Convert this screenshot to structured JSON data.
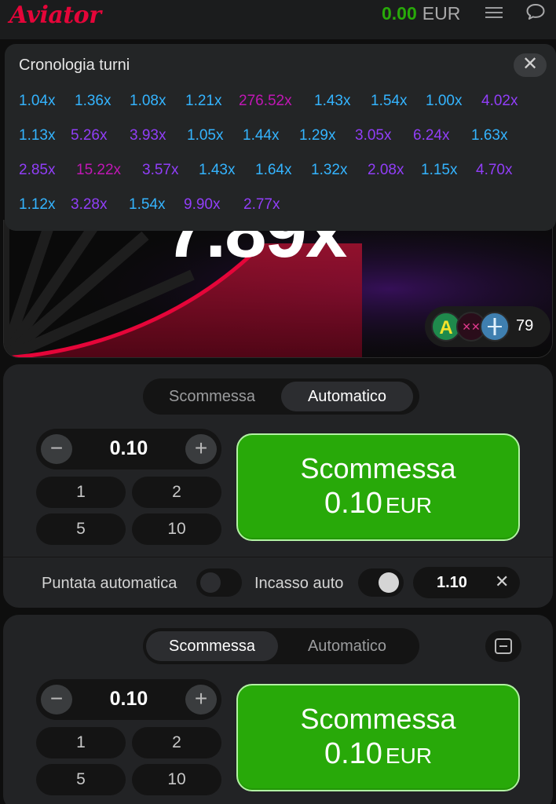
{
  "header": {
    "logo": "Aviator",
    "balance_amount": "0.00",
    "balance_currency": "EUR",
    "icons": [
      "menu-icon",
      "chat-icon"
    ]
  },
  "game": {
    "multiplier": "7.89x",
    "players_count": "79"
  },
  "history": {
    "title": "Cronologia turni",
    "close_label": "✕",
    "items": [
      {
        "label": "1.04x",
        "color": "#34b4ff"
      },
      {
        "label": "1.36x",
        "color": "#34b4ff"
      },
      {
        "label": "1.08x",
        "color": "#34b4ff"
      },
      {
        "label": "1.21x",
        "color": "#34b4ff"
      },
      {
        "label": "276.52x",
        "color": "#c017b4"
      },
      {
        "label": "1.43x",
        "color": "#34b4ff"
      },
      {
        "label": "1.54x",
        "color": "#34b4ff"
      },
      {
        "label": "1.00x",
        "color": "#34b4ff"
      },
      {
        "label": "4.02x",
        "color": "#913ef8"
      },
      {
        "label": "1.13x",
        "color": "#34b4ff"
      },
      {
        "label": "5.26x",
        "color": "#913ef8"
      },
      {
        "label": "3.93x",
        "color": "#913ef8"
      },
      {
        "label": "1.05x",
        "color": "#34b4ff"
      },
      {
        "label": "1.44x",
        "color": "#34b4ff"
      },
      {
        "label": "1.29x",
        "color": "#34b4ff"
      },
      {
        "label": "3.05x",
        "color": "#913ef8"
      },
      {
        "label": "6.24x",
        "color": "#913ef8"
      },
      {
        "label": "1.63x",
        "color": "#34b4ff"
      },
      {
        "label": "2.85x",
        "color": "#913ef8"
      },
      {
        "label": "15.22x",
        "color": "#c017b4"
      },
      {
        "label": "3.57x",
        "color": "#913ef8"
      },
      {
        "label": "1.43x",
        "color": "#34b4ff"
      },
      {
        "label": "1.64x",
        "color": "#34b4ff"
      },
      {
        "label": "1.32x",
        "color": "#34b4ff"
      },
      {
        "label": "2.08x",
        "color": "#913ef8"
      },
      {
        "label": "1.15x",
        "color": "#34b4ff"
      },
      {
        "label": "4.70x",
        "color": "#913ef8"
      },
      {
        "label": "1.12x",
        "color": "#34b4ff"
      },
      {
        "label": "3.28x",
        "color": "#913ef8"
      },
      {
        "label": "1.54x",
        "color": "#34b4ff"
      },
      {
        "label": "9.90x",
        "color": "#913ef8"
      },
      {
        "label": "2.77x",
        "color": "#913ef8"
      }
    ]
  },
  "bet_panel_1": {
    "tab_bet": "Scommessa",
    "tab_auto": "Automatico",
    "active_tab": "Automatico",
    "stepper_minus": "−",
    "stepper_value": "0.10",
    "stepper_plus": "+",
    "quick_amounts": [
      "1",
      "2",
      "5",
      "10"
    ],
    "bet_button_label": "Scommessa",
    "bet_button_amount": "0.10",
    "bet_button_currency": "EUR",
    "auto_bet_label": "Puntata automatica",
    "auto_cashout_label": "Incasso auto",
    "auto_cashout_value": "1.10",
    "auto_cashout_clear": "✕"
  },
  "bet_panel_2": {
    "tab_bet": "Scommessa",
    "tab_auto": "Automatico",
    "active_tab": "Scommessa",
    "stepper_minus": "−",
    "stepper_value": "0.10",
    "stepper_plus": "+",
    "quick_amounts": [
      "1",
      "2",
      "5",
      "10"
    ],
    "bet_button_label": "Scommessa",
    "bet_button_amount": "0.10",
    "bet_button_currency": "EUR"
  },
  "colors": {
    "accent_green": "#28a909",
    "brand_red": "#e50539",
    "low_multiplier": "#34b4ff",
    "mid_multiplier": "#913ef8",
    "high_multiplier": "#c017b4"
  }
}
